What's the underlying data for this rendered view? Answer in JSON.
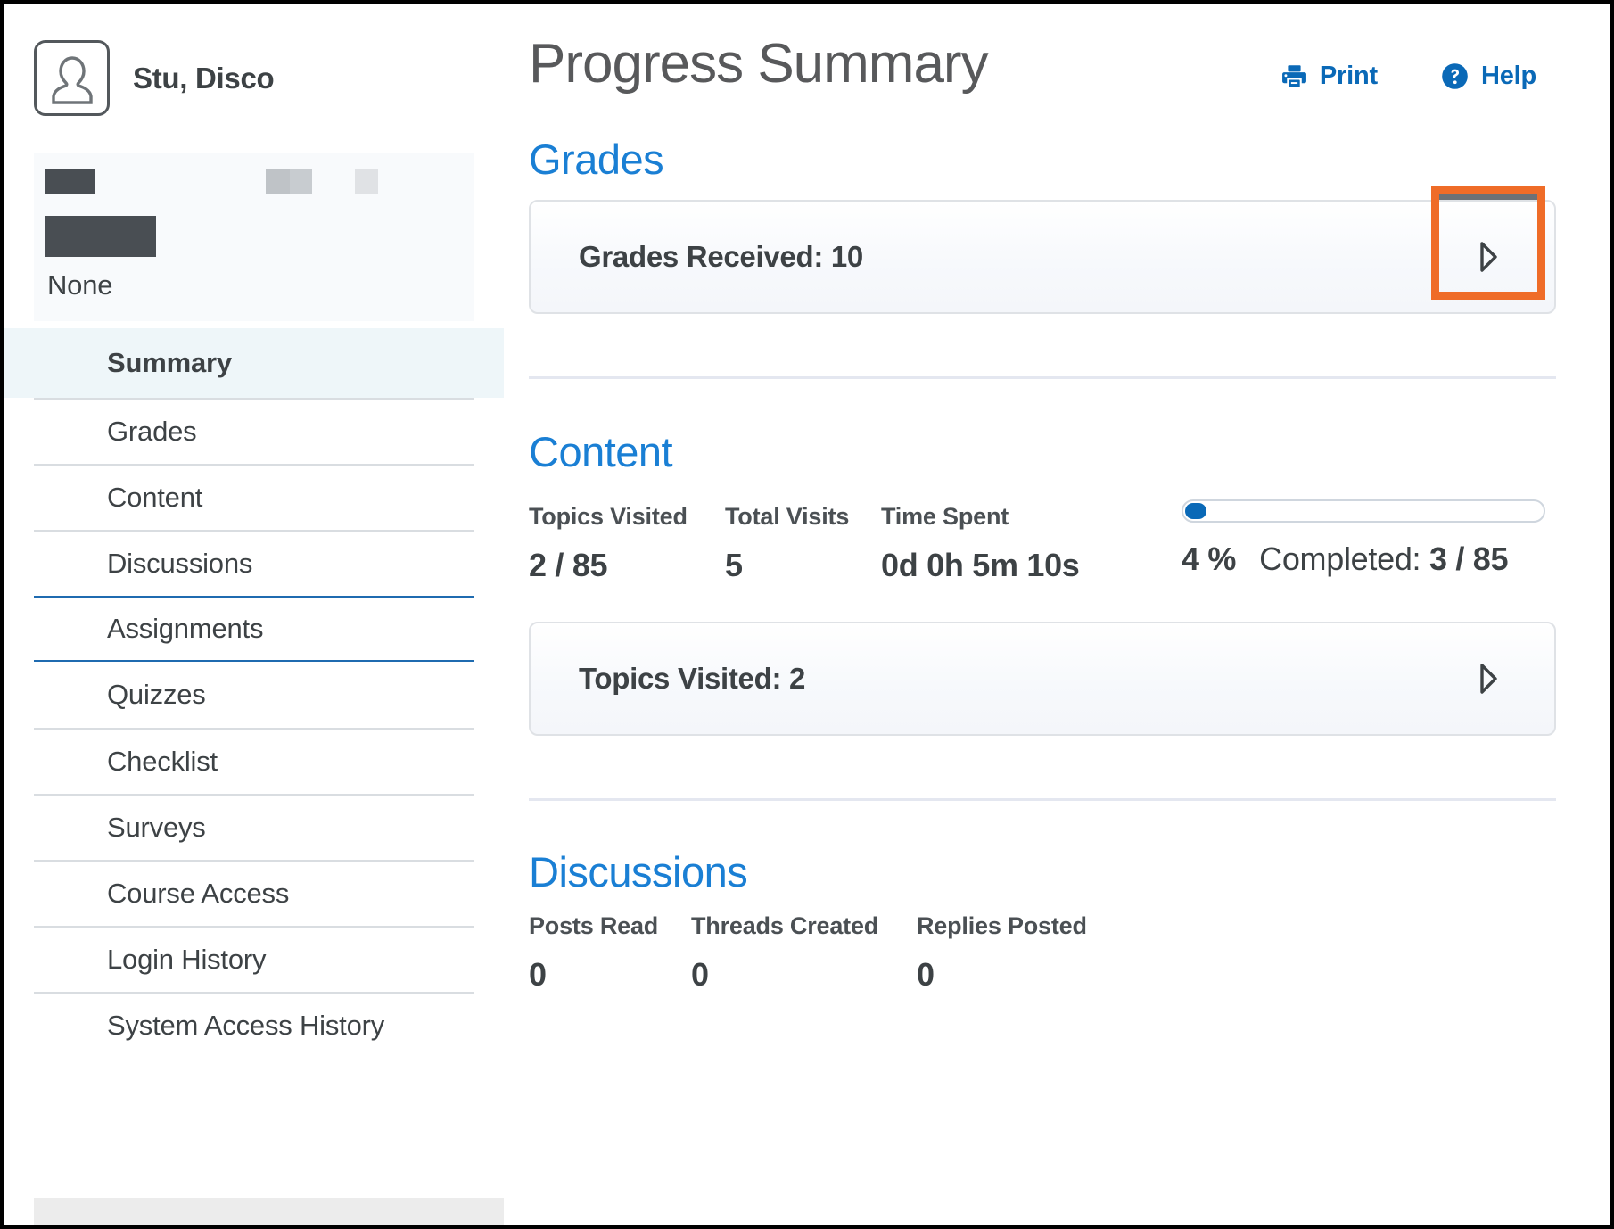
{
  "window": {
    "frame_color": "#000000"
  },
  "sidebar": {
    "avatar_icon": "user-avatar-icon",
    "profile_name": "Stu, Disco",
    "course_block": {
      "redacted": true,
      "none_label": "None"
    },
    "items": [
      {
        "label": "Summary",
        "active": true
      },
      {
        "label": "Grades",
        "active": false
      },
      {
        "label": "Content",
        "active": false
      },
      {
        "label": "Discussions",
        "active": false
      },
      {
        "label": "Assignments",
        "active": false
      },
      {
        "label": "Quizzes",
        "active": false
      },
      {
        "label": "Checklist",
        "active": false
      },
      {
        "label": "Surveys",
        "active": false
      },
      {
        "label": "Course Access",
        "active": false
      },
      {
        "label": "Login History",
        "active": false
      },
      {
        "label": "System Access History",
        "active": false
      }
    ]
  },
  "header": {
    "title": "Progress Summary",
    "print_label": "Print",
    "print_icon": "printer-icon",
    "help_label": "Help",
    "help_icon": "question-circle-icon",
    "link_color": "#0a69b7"
  },
  "grades": {
    "section_title": "Grades",
    "card_label": "Grades Received: 10",
    "expand_icon": "chevron-right-icon",
    "highlight_color": "#ef6c28"
  },
  "content": {
    "section_title": "Content",
    "stats": [
      {
        "label": "Topics Visited",
        "value": "2 / 85"
      },
      {
        "label": "Total Visits",
        "value": "5"
      },
      {
        "label": "Time Spent",
        "value": "0d 0h 5m 10s"
      }
    ],
    "progress_percent_label": "4 %",
    "progress_percent_value": 4,
    "completed_label": "Completed:",
    "completed_value": "3 / 85",
    "card_label": "Topics Visited: 2",
    "expand_icon": "chevron-right-icon"
  },
  "discussions": {
    "section_title": "Discussions",
    "stats": [
      {
        "label": "Posts Read",
        "value": "0"
      },
      {
        "label": "Threads Created",
        "value": "0"
      },
      {
        "label": "Replies Posted",
        "value": "0"
      }
    ]
  }
}
